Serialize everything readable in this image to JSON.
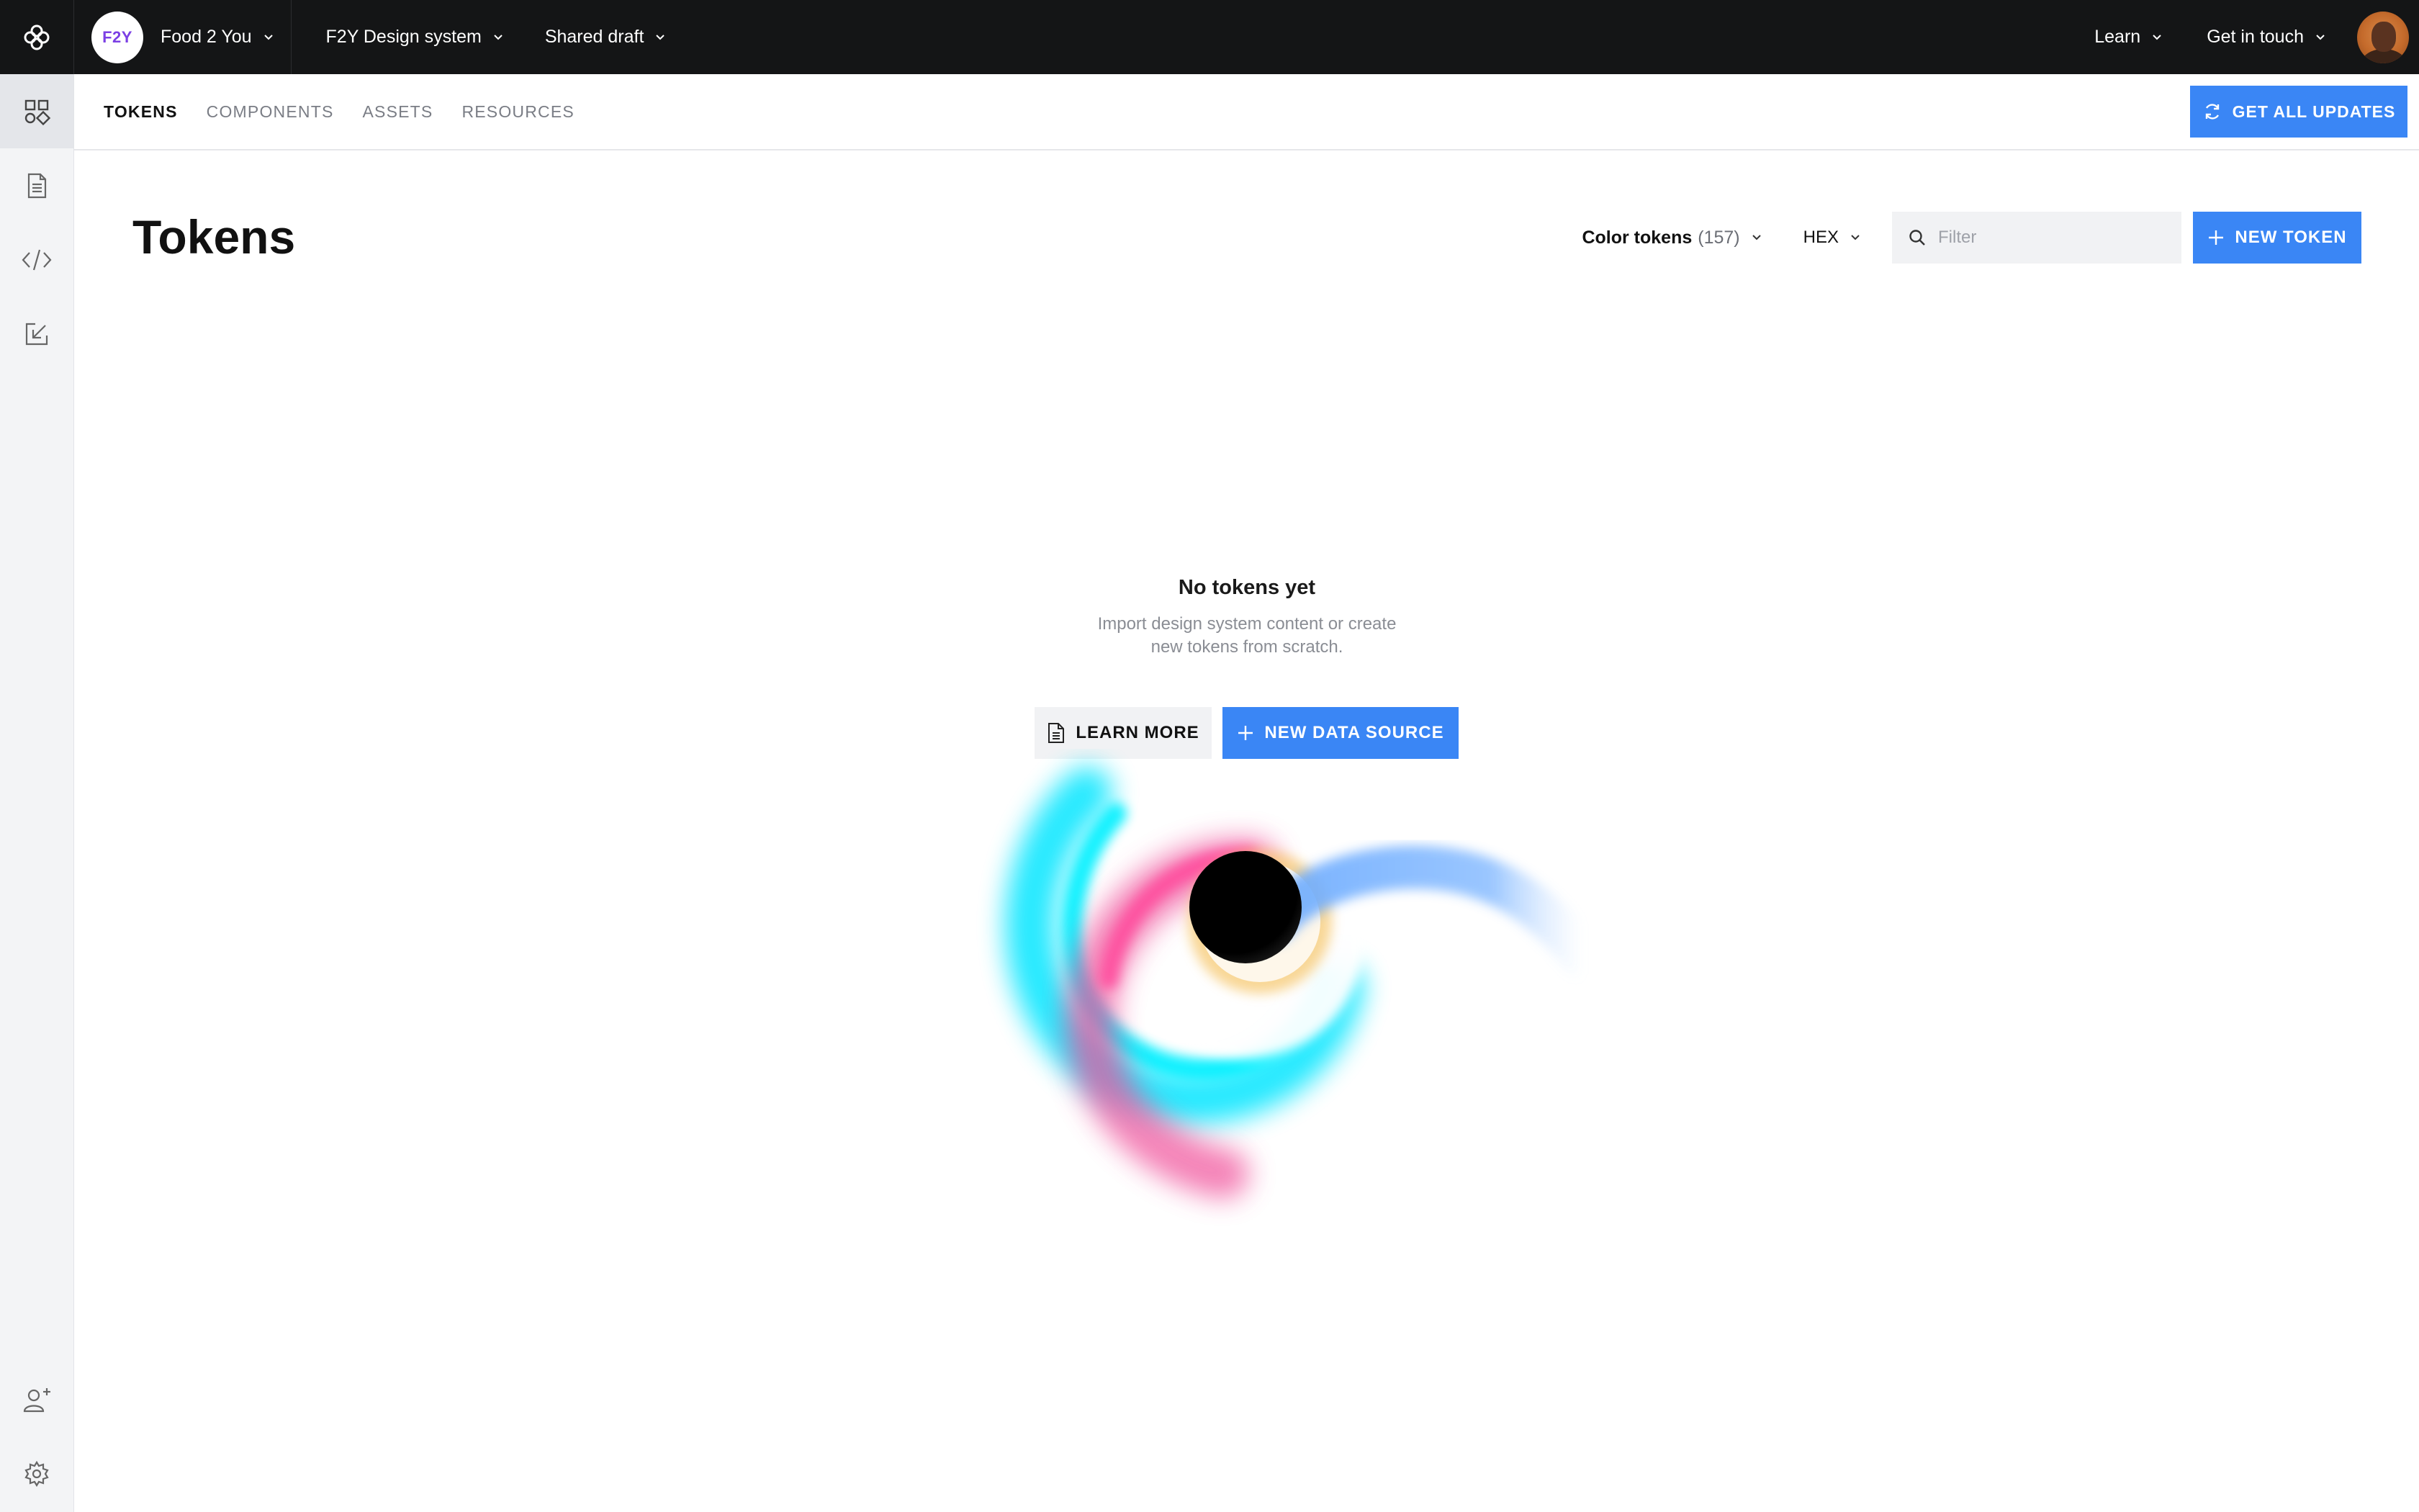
{
  "topbar": {
    "workspace_badge": "F2Y",
    "workspace_name": "Food 2 You",
    "design_system": "F2Y Design system",
    "version": "Shared draft",
    "learn": "Learn",
    "get_in_touch": "Get in touch"
  },
  "sidebar": {
    "items": [
      {
        "icon": "grid-shapes-icon",
        "active": true
      },
      {
        "icon": "document-icon",
        "active": false
      },
      {
        "icon": "code-icon",
        "active": false
      },
      {
        "icon": "import-arrow-icon",
        "active": false
      }
    ],
    "bottom": [
      {
        "icon": "add-user-icon"
      },
      {
        "icon": "gear-icon"
      }
    ]
  },
  "subnav": {
    "tabs": [
      {
        "label": "TOKENS",
        "active": true
      },
      {
        "label": "COMPONENTS",
        "active": false
      },
      {
        "label": "ASSETS",
        "active": false
      },
      {
        "label": "RESOURCES",
        "active": false
      }
    ],
    "update_button": "GET ALL UPDATES"
  },
  "page": {
    "title": "Tokens",
    "token_type": "Color tokens",
    "token_count": "(157)",
    "format": "HEX",
    "filter_placeholder": "Filter",
    "new_token_button": "NEW TOKEN"
  },
  "empty_state": {
    "title": "No tokens yet",
    "description": "Import design system content or create new tokens from scratch.",
    "learn_more": "LEARN MORE",
    "new_data_source": "NEW DATA SOURCE"
  },
  "colors": {
    "topbar_bg": "#141516",
    "accent_blue": "#3a86f5",
    "badge_text": "#7b3fe4",
    "rail_bg": "#f3f4f6",
    "swirl_cyan": "#00e5ff",
    "swirl_pink": "#f0509a",
    "swirl_blue": "#6aaaff",
    "swirl_gold": "#f6c66b"
  }
}
